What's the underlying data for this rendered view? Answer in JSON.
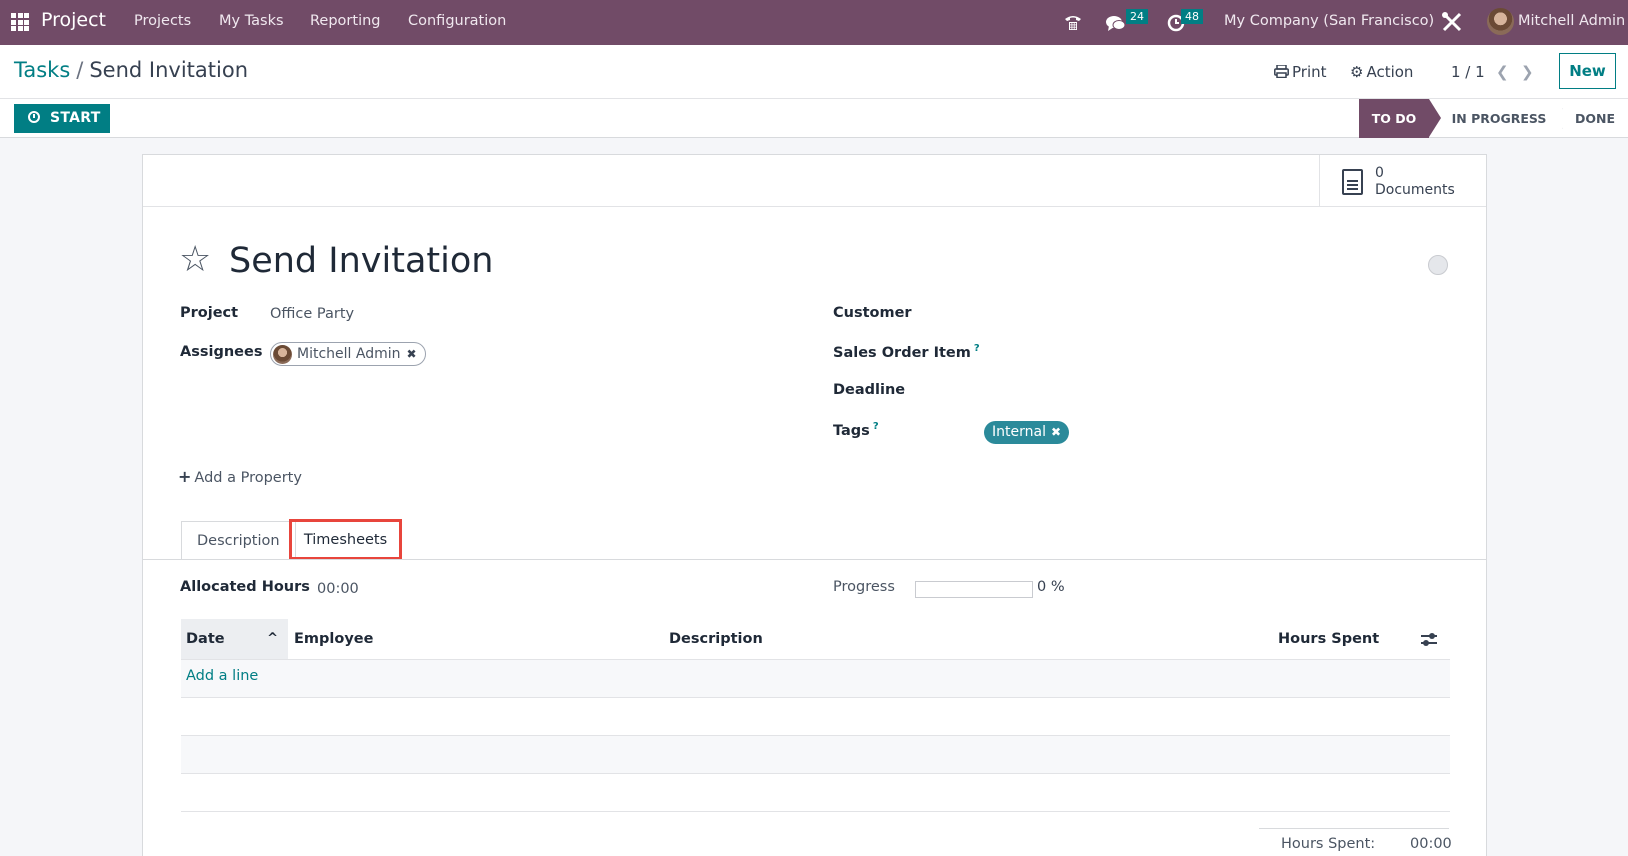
{
  "navbar": {
    "app_name": "Project",
    "menu": [
      "Projects",
      "My Tasks",
      "Reporting",
      "Configuration"
    ],
    "messages_count": "24",
    "activities_count": "48",
    "company": "My Company (San Francisco)",
    "user": "Mitchell Admin",
    "icons": {
      "apps": "grid-icon",
      "phone": "phone-icon",
      "messages": "chat-icon",
      "activities": "clock-icon",
      "debug": "tools-icon"
    }
  },
  "control_panel": {
    "breadcrumb": {
      "parent": "Tasks",
      "separator": "/",
      "current": "Send Invitation"
    },
    "print_label": "Print",
    "action_label": "Action",
    "pager": "1 / 1",
    "new_label": "New",
    "start_label": "START",
    "stages": [
      {
        "label": "TO DO",
        "active": true
      },
      {
        "label": "IN PROGRESS",
        "active": false
      },
      {
        "label": "DONE",
        "active": false
      }
    ]
  },
  "form": {
    "documents_count": "0",
    "documents_label": "Documents",
    "title": "Send Invitation",
    "fields_left": {
      "project_label": "Project",
      "project_value": "Office Party",
      "assignees_label": "Assignees",
      "assignees": [
        "Mitchell Admin"
      ]
    },
    "fields_right": {
      "customer_label": "Customer",
      "customer_value": "",
      "sales_order_item_label": "Sales Order Item",
      "deadline_label": "Deadline",
      "deadline_value": "",
      "tags_label": "Tags",
      "tags": [
        {
          "label": "Internal",
          "color": "#2b8a9a"
        }
      ]
    },
    "help_marker": "?",
    "add_property_label": "Add a Property",
    "tabs": [
      {
        "label": "Description",
        "active": false
      },
      {
        "label": "Timesheets",
        "active": true,
        "highlighted": true
      }
    ],
    "timesheets": {
      "allocated_hours_label": "Allocated Hours",
      "allocated_hours_value": "00:00",
      "progress_label": "Progress",
      "progress_percent": 0,
      "progress_text": "0 %",
      "columns": [
        "Date",
        "Employee",
        "Description",
        "Hours Spent"
      ],
      "rows": [],
      "add_line_label": "Add a line",
      "total_label": "Hours Spent:",
      "total_value": "00:00"
    }
  },
  "colors": {
    "brand": "#714b67",
    "accent": "#017e84",
    "highlight_box": "#e8453c"
  }
}
